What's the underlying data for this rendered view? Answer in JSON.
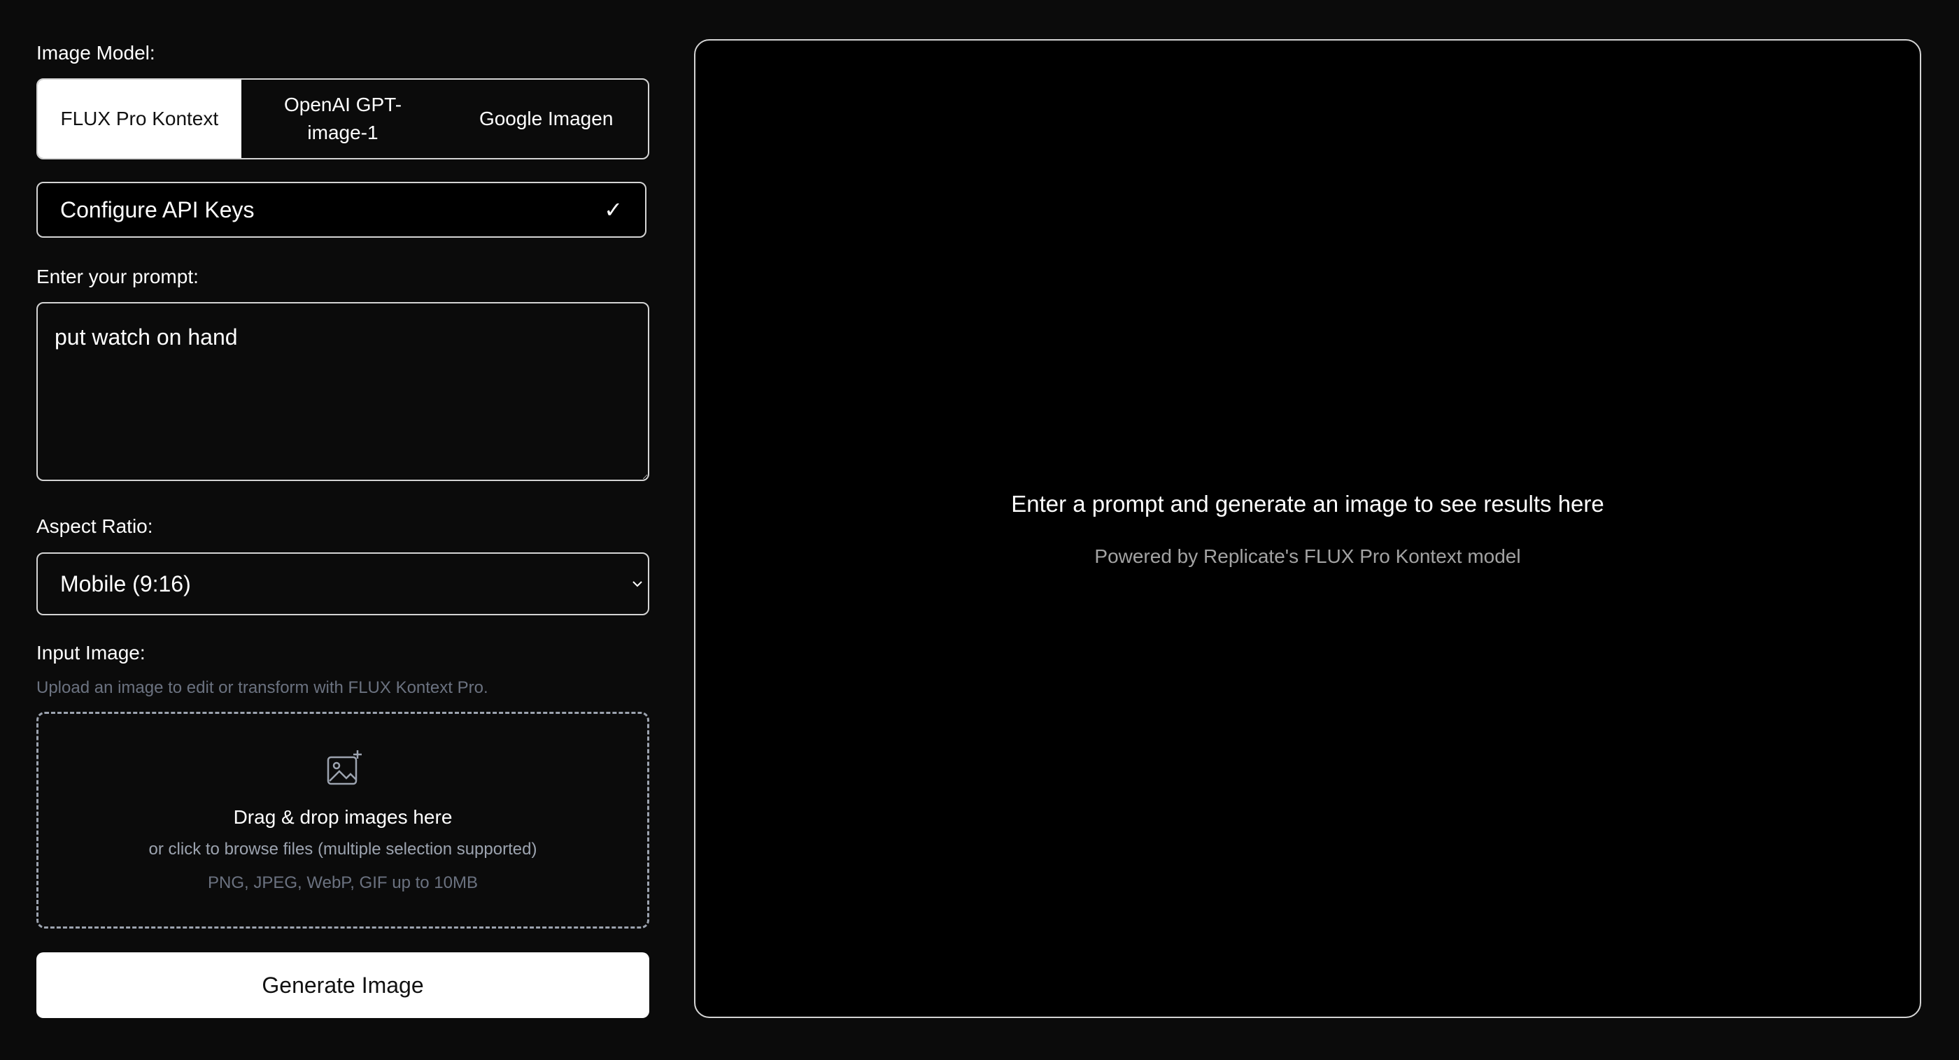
{
  "sidebar": {
    "model_label": "Image Model:",
    "models": [
      {
        "label": "FLUX Pro Kontext",
        "active": true
      },
      {
        "label": "OpenAI GPT-image-1",
        "active": false
      },
      {
        "label": "Google Imagen",
        "active": false
      }
    ],
    "api_keys": {
      "label": "Configure API Keys",
      "status_icon": "✓"
    },
    "prompt_label": "Enter your prompt:",
    "prompt_value": "put watch on hand",
    "aspect_label": "Aspect Ratio:",
    "aspect_value": "Mobile (9:16)",
    "input_image": {
      "label": "Input Image:",
      "hint": "Upload an image to edit or transform with FLUX Kontext Pro.",
      "drop_icon": "image-plus-icon",
      "drop_title": "Drag & drop images here",
      "drop_sub": "or click to browse files (multiple selection supported)",
      "drop_types": "PNG, JPEG, WebP, GIF up to 10MB"
    },
    "generate_label": "Generate Image"
  },
  "preview": {
    "title": "Enter a prompt and generate an image to see results here",
    "subtitle": "Powered by Replicate's FLUX Pro Kontext model"
  },
  "colors": {
    "background": "#0b0b0b",
    "panel": "#000000",
    "border": "#d4d4d4",
    "accent": "#ffffff",
    "muted": "#6b7280"
  }
}
